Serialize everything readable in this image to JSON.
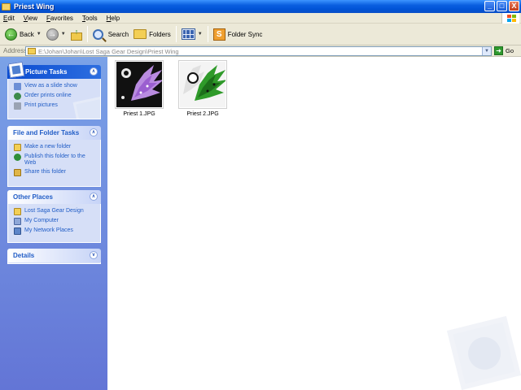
{
  "window": {
    "title": "Priest Wing",
    "buttons": {
      "minimize": "_",
      "maximize": "□",
      "close": "X"
    }
  },
  "menu": {
    "items": [
      {
        "u": "E",
        "rest": "dit"
      },
      {
        "u": "V",
        "rest": "iew"
      },
      {
        "u": "F",
        "rest": "avorites"
      },
      {
        "u": "T",
        "rest": "ools"
      },
      {
        "u": "H",
        "rest": "elp"
      }
    ]
  },
  "toolbar": {
    "back_label": "Back",
    "search_label": "Search",
    "folders_label": "Folders",
    "folder_sync_label": "Folder Sync"
  },
  "address": {
    "label": "Address",
    "value": "E:\\Johan\\Johan\\Lost Saga Gear Design\\Priest Wing",
    "go_label": "Go"
  },
  "taskpane": {
    "picture_tasks": {
      "title": "Picture Tasks",
      "items": [
        "View as a slide show",
        "Order prints online",
        "Print pictures"
      ]
    },
    "file_folder_tasks": {
      "title": "File and Folder Tasks",
      "items": [
        "Make a new folder",
        "Publish this folder to the Web",
        "Share this folder"
      ]
    },
    "other_places": {
      "title": "Other Places",
      "items": [
        "Lost Saga Gear Design",
        "My Computer",
        "My Network Places"
      ]
    },
    "details": {
      "title": "Details"
    }
  },
  "files": [
    {
      "name": "Priest 1.JPG"
    },
    {
      "name": "Priest 2.JPG"
    }
  ],
  "colors": {
    "titlebar": "#0053d6",
    "taskpane_top": "#7ba2e7",
    "taskpane_bottom": "#6375d6",
    "link": "#215dc6"
  }
}
